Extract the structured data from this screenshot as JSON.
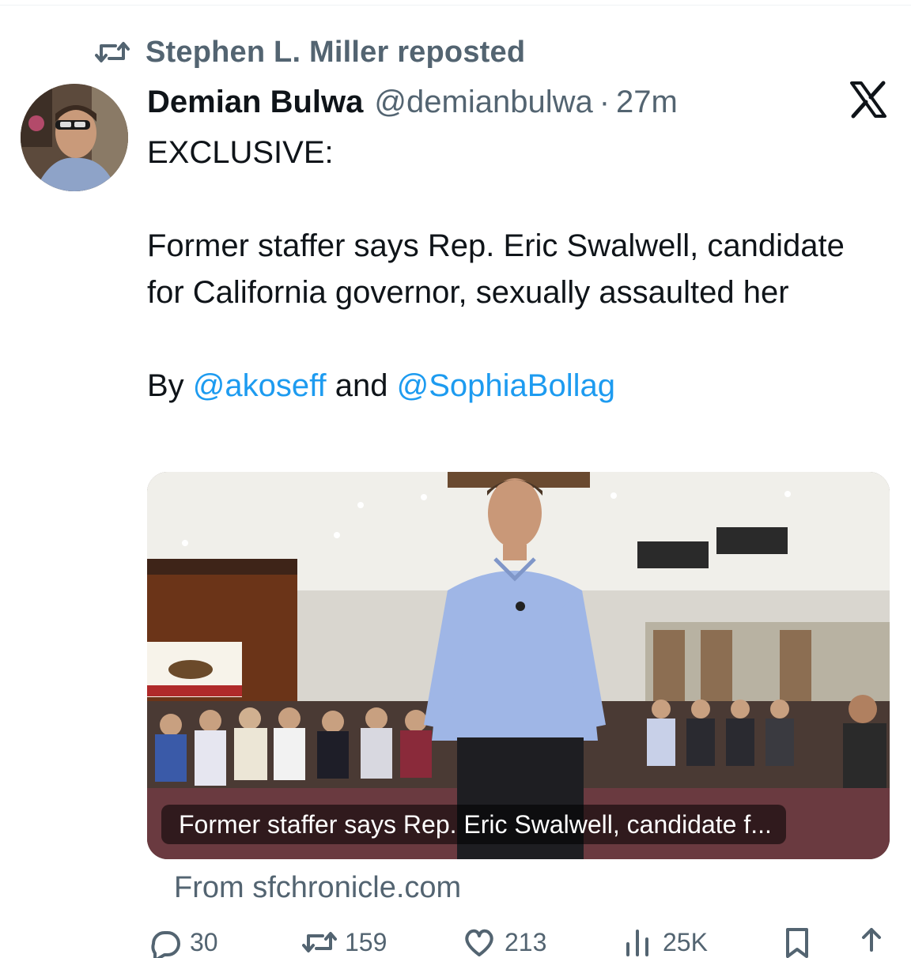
{
  "repost": {
    "text": "Stephen L. Miller reposted",
    "icon": "repost-icon"
  },
  "author": {
    "display_name": "Demian Bulwa",
    "handle": "@demianbulwa",
    "separator": "·",
    "time": "27m",
    "avatar_icon": "avatar"
  },
  "tweet": {
    "line1": "EXCLUSIVE:",
    "line2": "Former staffer says Rep. Eric Swalwell, candidate for California governor, sexually assaulted her",
    "byline_prefix": "By ",
    "mention1": "@akoseff",
    "byline_and": " and ",
    "mention2": "@SophiaBollag"
  },
  "card": {
    "caption": "Former staffer says Rep. Eric Swalwell, candidate f..."
  },
  "source": "From sfchronicle.com",
  "actions": {
    "replies": "30",
    "reposts": "159",
    "likes": "213",
    "views": "25K"
  },
  "colors": {
    "link": "#1d9bf0",
    "secondary": "#536471",
    "text": "#0f1419"
  },
  "logo": "x-logo"
}
